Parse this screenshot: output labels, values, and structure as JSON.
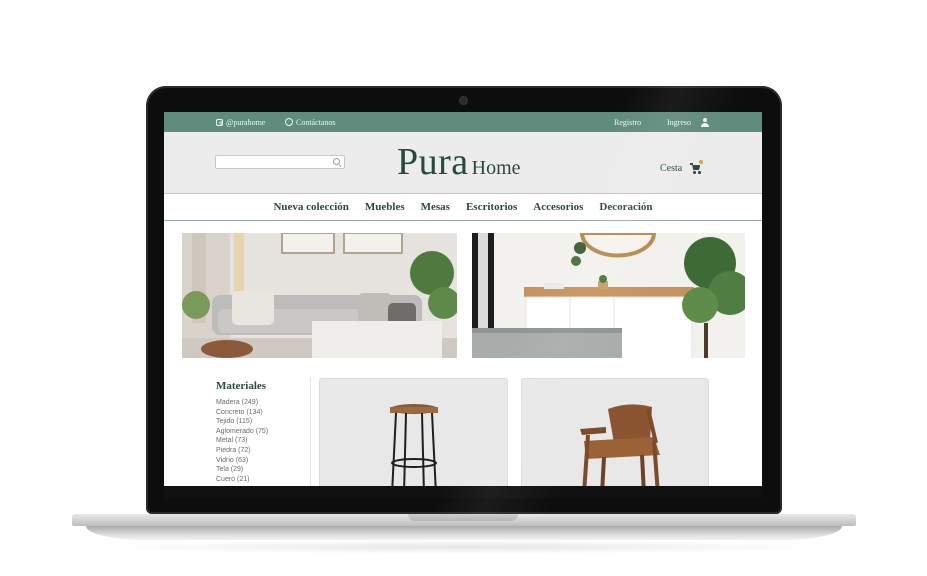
{
  "topbar": {
    "instagram_label": "@purahome",
    "whatsapp_label": "Contáctanos",
    "register_label": "Registro",
    "login_label": "Ingreso"
  },
  "header": {
    "search_placeholder": "",
    "logo_main": "Pura",
    "logo_sub": "Home",
    "cart_label": "Cesta"
  },
  "nav": {
    "items": [
      "Nueva colección",
      "Muebles",
      "Mesas",
      "Escritorios",
      "Accesorios",
      "Decoración"
    ]
  },
  "banners": {
    "left": "living-room-sofa-image",
    "right": "bedroom-dresser-image"
  },
  "materials": {
    "title": "Materiales",
    "items": [
      "Madera (249)",
      "Concreto (134)",
      "Tejido (115)",
      "Aglomerado (75)",
      "Metal (73)",
      "Piedra (72)",
      "Vidrio (63)",
      "Tela (29)",
      "Cuero (21)"
    ]
  },
  "products": [
    {
      "image": "bar-stool-image"
    },
    {
      "image": "wooden-armchair-image"
    }
  ],
  "colors": {
    "brand_green": "#5f8c7d",
    "logo_green": "#264b3e",
    "header_bg": "#ececec",
    "cart_badge": "#e0a12a"
  }
}
